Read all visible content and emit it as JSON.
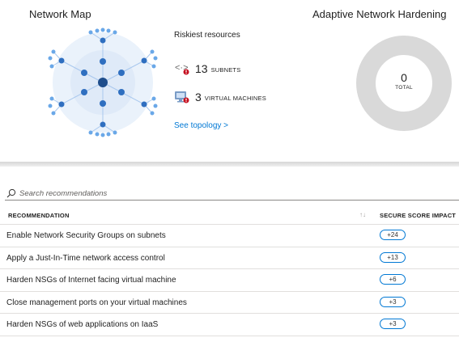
{
  "network_map": {
    "title": "Network Map",
    "riskiest_title": "Riskiest resources",
    "subnets": {
      "count": "13",
      "label": "SUBNETS",
      "icon": "subnet-icon"
    },
    "vms": {
      "count": "3",
      "label": "VIRTUAL MACHINES",
      "icon": "virtual-machine-icon"
    },
    "see_topology": "See topology >"
  },
  "adaptive": {
    "title": "Adaptive Network Hardening",
    "total_value": "0",
    "total_label": "TOTAL"
  },
  "search": {
    "placeholder": "Search recommendations"
  },
  "table": {
    "col_recommendation": "RECOMMENDATION",
    "col_sort": "↑↓",
    "col_impact": "SECURE SCORE IMPACT",
    "rows": [
      {
        "text": "Enable Network Security Groups on subnets",
        "impact": "+24"
      },
      {
        "text": "Apply a Just-In-Time network access control",
        "impact": "+13"
      },
      {
        "text": "Harden NSGs of Internet facing virtual machine",
        "impact": "+6"
      },
      {
        "text": "Close management ports on your virtual machines",
        "impact": "+3"
      },
      {
        "text": "Harden NSGs of web applications on IaaS",
        "impact": "+3"
      }
    ]
  },
  "colors": {
    "accent": "#0078d4",
    "node_dark": "#1f4e8c",
    "node_mid": "#2f6fc0",
    "node_light": "#6aa8e8",
    "donut": "#d9d9d9",
    "alert": "#c50f1f"
  }
}
